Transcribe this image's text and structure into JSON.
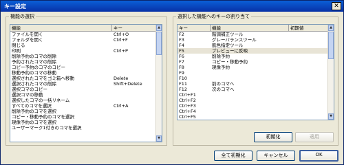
{
  "window": {
    "title": "キー設定",
    "close_glyph": "✕"
  },
  "left_panel": {
    "legend": "機能の選択",
    "columns": [
      "機能",
      "キー"
    ],
    "rows": [
      [
        "ファイルを開く",
        "Ctrl+O"
      ],
      [
        "フォルダを開く",
        "Ctrl+F"
      ],
      [
        "閉じる",
        ""
      ],
      [
        "印刷",
        "Ctrl+P"
      ],
      [
        "削除予約のコマの削除",
        ""
      ],
      [
        "予約されたコマの削除",
        ""
      ],
      [
        "コピー予約のコマのコピー",
        ""
      ],
      [
        "移動予約のコマの移動",
        ""
      ],
      [
        "選択されたコマをゴミ箱へ移動",
        "Delete"
      ],
      [
        "選択されたコマの削除",
        "Shift+Delete"
      ],
      [
        "選択コマのコピー",
        ""
      ],
      [
        "選択コマの移動",
        ""
      ],
      [
        "選択したコマの一括リネーム",
        ""
      ],
      [
        "すべてのコマを選択",
        "Ctrl+A"
      ],
      [
        "削除予約のコマを選択",
        ""
      ],
      [
        "コピー・移動予約のコマを選択",
        ""
      ],
      [
        "現像予約のコマを選択",
        ""
      ],
      [
        "ユーザーマーク1付きのコマを選択",
        ""
      ]
    ]
  },
  "right_panel": {
    "legend": "選択した機能へのキーの割り当て",
    "columns": [
      "キー",
      "機能",
      "初期値"
    ],
    "rows": [
      [
        "F2",
        "階調補正ツール",
        ""
      ],
      [
        "F3",
        "グレーバランスツール",
        ""
      ],
      [
        "F4",
        "肌色指定ツール",
        ""
      ],
      [
        "F5",
        "プレビューに反映",
        ""
      ],
      [
        "F6",
        "削除予約",
        ""
      ],
      [
        "F7",
        "コピー・移動予約",
        ""
      ],
      [
        "F8",
        "現像予約",
        ""
      ],
      [
        "F9",
        "",
        ""
      ],
      [
        "F10",
        "",
        ""
      ],
      [
        "F11",
        "前のコマへ",
        ""
      ],
      [
        "F12",
        "次のコマへ",
        ""
      ],
      [
        "Ctrl+F1",
        "",
        ""
      ],
      [
        "Ctrl+F2",
        "",
        ""
      ],
      [
        "Ctrl+F3",
        "",
        ""
      ],
      [
        "Ctrl+F4",
        "",
        ""
      ],
      [
        "Ctrl+F5",
        "",
        ""
      ]
    ],
    "selected_row": 3,
    "reset_label": "初期化",
    "apply_label": "適用"
  },
  "footer": {
    "reset_all_label": "全て初期化",
    "cancel_label": "キャンセル",
    "ok_label": "OK"
  }
}
